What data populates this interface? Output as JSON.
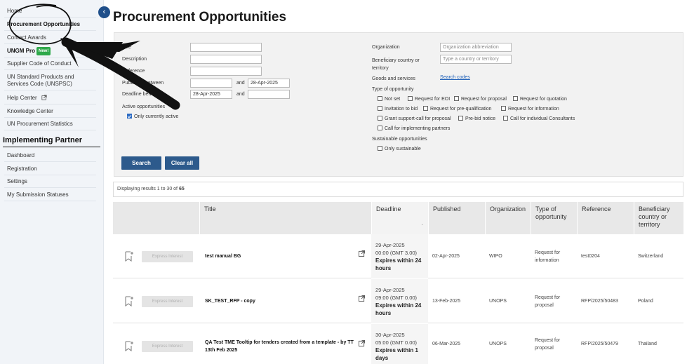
{
  "sidebar": {
    "items": [
      {
        "label": "Home"
      },
      {
        "label": "Procurement Opportunities"
      },
      {
        "label": "Contact Awards"
      },
      {
        "label": "UNGM Pro",
        "badge": "New!"
      },
      {
        "label": "Supplier Code of Conduct"
      },
      {
        "label": "UN Standard Products and Services Code (UNSPSC)"
      },
      {
        "label": "Help Center"
      },
      {
        "label": "Knowledge Center"
      },
      {
        "label": "UN Procurement Statistics"
      }
    ],
    "section_heading": "Implementing Partner",
    "partner_items": [
      {
        "label": "Dashboard"
      },
      {
        "label": "Registration"
      },
      {
        "label": "Settings"
      },
      {
        "label": "My Submission Statuses"
      }
    ]
  },
  "page": {
    "title": "Procurement Opportunities"
  },
  "filters": {
    "title_label": "Title",
    "description_label": "Description",
    "reference_label": "Reference",
    "published_label": "Published between",
    "published_to": "28-Apr-2025",
    "deadline_label": "Deadline between",
    "deadline_from": "28-Apr-2025",
    "and_label": "and",
    "active_label": "Active opportunities",
    "only_active_label": "Only currently active",
    "organization_label": "Organization",
    "organization_placeholder": "Organization abbreviation",
    "beneficiary_label": "Beneficiary country or territory",
    "beneficiary_placeholder": "Type a country or territory",
    "goods_label": "Goods and services",
    "search_codes_link": "Search codes",
    "type_label": "Type of opportunity",
    "types": [
      "Not set",
      "Request for EOI",
      "Request for proposal",
      "Request for quotation",
      "Invitation to bid",
      "Request for pre-qualification",
      "Request for information",
      "Grant support-call for proposal",
      "Pre-bid notice",
      "Call for individual Consultants",
      "Call for implementing partners"
    ],
    "sustainable_label": "Sustainable opportunities",
    "only_sustainable_label": "Only sustainable",
    "search_button": "Search",
    "clear_button": "Clear all"
  },
  "results": {
    "prefix": "Displaying results 1 to 30 of ",
    "total": "65"
  },
  "table": {
    "headers": [
      "Title",
      "Deadline",
      "Published",
      "Organization",
      "Type of opportunity",
      "Reference",
      "Beneficiary country or territory"
    ],
    "express_label": "Express Interest",
    "rows": [
      {
        "title": "test manual BG",
        "deadline_date": "29-Apr-2025",
        "deadline_time": "00:00 (GMT 3.00)",
        "expires": "Expires within 24 hours",
        "published": "02-Apr-2025",
        "organization": "WIPO",
        "type": "Request for information",
        "reference": "test0204",
        "country": "Switzerland"
      },
      {
        "title": "SK_TEST_RFP - copy",
        "deadline_date": "29-Apr-2025",
        "deadline_time": "09:00 (GMT 0.00)",
        "expires": "Expires within 24 hours",
        "published": "13-Feb-2025",
        "organization": "UNOPS",
        "type": "Request for proposal",
        "reference": "RFP/2025/50483",
        "country": "Poland"
      },
      {
        "title": "QA Test TME Tooltip for tenders created from a template - by TT 13th Feb 2025",
        "deadline_date": "30-Apr-2025",
        "deadline_time": "05:00 (GMT 0.00)",
        "expires": "Expires within 1 days",
        "published": "06-Mar-2025",
        "organization": "UNOPS",
        "type": "Request for proposal",
        "reference": "RFP/2025/50479",
        "country": "Thailand"
      }
    ]
  }
}
